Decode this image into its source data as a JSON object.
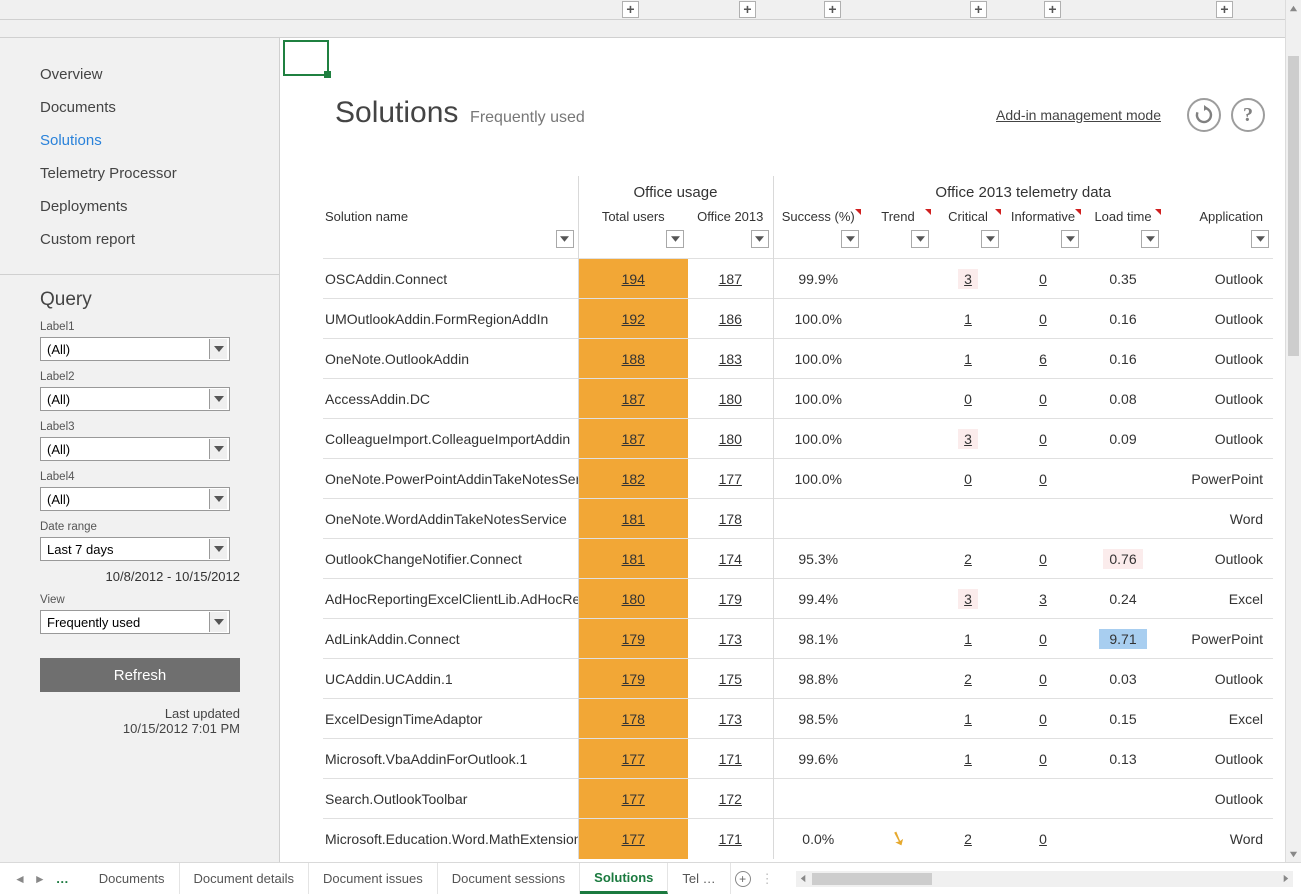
{
  "nav": {
    "items": [
      {
        "label": "Overview"
      },
      {
        "label": "Documents"
      },
      {
        "label": "Solutions",
        "active": true
      },
      {
        "label": "Telemetry Processor"
      },
      {
        "label": "Deployments"
      },
      {
        "label": "Custom report"
      }
    ]
  },
  "query": {
    "title": "Query",
    "filters": [
      {
        "label": "Label1",
        "value": "(All)"
      },
      {
        "label": "Label2",
        "value": "(All)"
      },
      {
        "label": "Label3",
        "value": "(All)"
      },
      {
        "label": "Label4",
        "value": "(All)"
      }
    ],
    "date_range_label": "Date range",
    "date_range_value": "Last 7 days",
    "date_range_text": "10/8/2012 - 10/15/2012",
    "view_label": "View",
    "view_value": "Frequently used",
    "refresh_label": "Refresh",
    "last_updated_label": "Last updated",
    "last_updated_value": "10/15/2012 7:01 PM"
  },
  "title": {
    "main": "Solutions",
    "sub": "Frequently used",
    "management_link": "Add-in management mode"
  },
  "table_headers": {
    "group_usage": "Office usage",
    "group_telemetry": "Office 2013 telemetry data",
    "col_name": "Solution name",
    "col_total": "Total users",
    "col_2013": "Office 2013",
    "col_success": "Success (%)",
    "col_trend": "Trend",
    "col_critical": "Critical",
    "col_inform": "Informative",
    "col_load": "Load time",
    "col_app": "Application"
  },
  "rows": [
    {
      "name": "OSCAddin.Connect",
      "total": "194",
      "o2013": "187",
      "success": "99.9%",
      "trend": "",
      "critical": "3",
      "critical_pink": true,
      "inform": "0",
      "load": "0.35",
      "app": "Outlook"
    },
    {
      "name": "UMOutlookAddin.FormRegionAddIn",
      "total": "192",
      "o2013": "186",
      "success": "100.0%",
      "trend": "",
      "critical": "1",
      "inform": "0",
      "load": "0.16",
      "app": "Outlook"
    },
    {
      "name": "OneNote.OutlookAddin",
      "total": "188",
      "o2013": "183",
      "success": "100.0%",
      "trend": "",
      "critical": "1",
      "inform": "6",
      "load": "0.16",
      "app": "Outlook"
    },
    {
      "name": "AccessAddin.DC",
      "total": "187",
      "o2013": "180",
      "success": "100.0%",
      "trend": "",
      "critical": "0",
      "inform": "0",
      "load": "0.08",
      "app": "Outlook"
    },
    {
      "name": "ColleagueImport.ColleagueImportAddin",
      "total": "187",
      "o2013": "180",
      "success": "100.0%",
      "trend": "",
      "critical": "3",
      "critical_pink": true,
      "inform": "0",
      "load": "0.09",
      "app": "Outlook"
    },
    {
      "name": "OneNote.PowerPointAddinTakeNotesService",
      "total": "182",
      "o2013": "177",
      "success": "100.0%",
      "trend": "",
      "critical": "0",
      "inform": "0",
      "load": "",
      "app": "PowerPoint"
    },
    {
      "name": "OneNote.WordAddinTakeNotesService",
      "total": "181",
      "o2013": "178",
      "success": "",
      "trend": "",
      "critical": "",
      "inform": "",
      "load": "",
      "app": "Word"
    },
    {
      "name": "OutlookChangeNotifier.Connect",
      "total": "181",
      "o2013": "174",
      "success": "95.3%",
      "trend": "",
      "critical": "2",
      "inform": "0",
      "load": "0.76",
      "load_pink": true,
      "app": "Outlook"
    },
    {
      "name": "AdHocReportingExcelClientLib.AdHocReportingExcelClient",
      "total": "180",
      "o2013": "179",
      "success": "99.4%",
      "trend": "",
      "critical": "3",
      "critical_pink": true,
      "inform": "3",
      "load": "0.24",
      "app": "Excel"
    },
    {
      "name": "AdLinkAddin.Connect",
      "total": "179",
      "o2013": "173",
      "success": "98.1%",
      "trend": "",
      "critical": "1",
      "inform": "0",
      "load": "9.71",
      "load_hl": true,
      "app": "PowerPoint"
    },
    {
      "name": "UCAddin.UCAddin.1",
      "total": "179",
      "o2013": "175",
      "success": "98.8%",
      "trend": "",
      "critical": "2",
      "inform": "0",
      "load": "0.03",
      "app": "Outlook"
    },
    {
      "name": "ExcelDesignTimeAdaptor",
      "total": "178",
      "o2013": "173",
      "success": "98.5%",
      "trend": "",
      "critical": "1",
      "inform": "0",
      "load": "0.15",
      "app": "Excel"
    },
    {
      "name": "Microsoft.VbaAddinForOutlook.1",
      "total": "177",
      "o2013": "171",
      "success": "99.6%",
      "trend": "",
      "critical": "1",
      "inform": "0",
      "load": "0.13",
      "app": "Outlook"
    },
    {
      "name": "Search.OutlookToolbar",
      "total": "177",
      "o2013": "172",
      "success": "",
      "trend": "",
      "critical": "",
      "inform": "",
      "load": "",
      "app": "Outlook"
    },
    {
      "name": "Microsoft.Education.Word.MathExtension",
      "total": "177",
      "o2013": "171",
      "success": "0.0%",
      "trend": "down",
      "critical": "2",
      "inform": "0",
      "load": "",
      "app": "Word"
    }
  ],
  "tabs": [
    "Documents",
    "Document details",
    "Document issues",
    "Document sessions",
    "Solutions",
    "Tel …"
  ],
  "active_tab": "Solutions",
  "collapse_positions": [
    622,
    739,
    824,
    970,
    1044,
    1216
  ]
}
